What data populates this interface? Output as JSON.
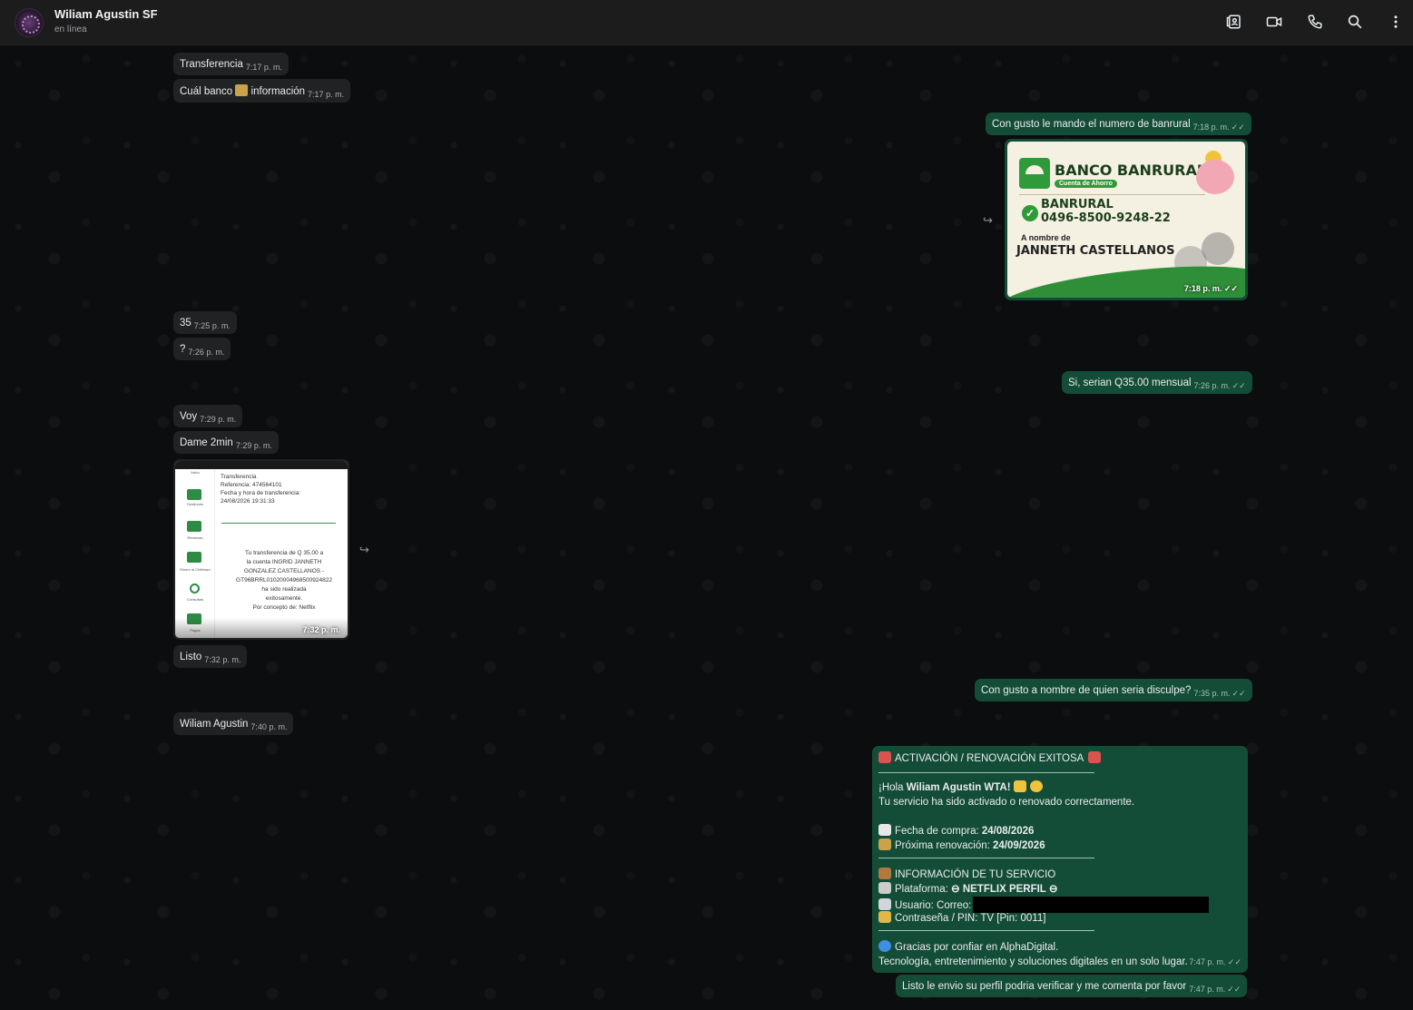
{
  "header": {
    "name": "Wiliam Agustin SF",
    "status": "en línea",
    "icons": [
      "contact-card-icon",
      "video-call-icon",
      "phone-icon",
      "search-icon",
      "more-options-icon"
    ]
  },
  "messages": {
    "m1": {
      "text": "Transferencia",
      "time": "7:17 p. m."
    },
    "m2": {
      "text_before": "Cuál banco",
      "text_after": "información",
      "time": "7:17 p. m."
    },
    "m3": {
      "text": "Con gusto le mando el numero de banrural",
      "time": "7:18 p. m."
    },
    "m4": {
      "time": "7:18 p. m."
    },
    "m5": {
      "text": "35",
      "time": "7:25 p. m."
    },
    "m6": {
      "text": "?",
      "time": "7:26 p. m."
    },
    "m7": {
      "text": "Si, serian Q35.00 mensual",
      "time": "7:26 p. m."
    },
    "m8": {
      "text": "Voy",
      "time": "7:29 p. m."
    },
    "m9": {
      "text": "Dame 2min",
      "time": "7:29 p. m."
    },
    "m10": {
      "time": "7:32 p. m."
    },
    "m11": {
      "text": "Listo",
      "time": "7:32 p. m."
    },
    "m12": {
      "text": "Con gusto a nombre de quien seria disculpe?",
      "time": "7:35 p. m."
    },
    "m13": {
      "text": "Wiliam Agustin",
      "time": "7:40 p. m."
    },
    "m14": {
      "time": "7:47 p. m."
    },
    "m15": {
      "text": "Listo le envio su perfil podria verificar y me comenta por favor",
      "time": "7:47 p. m."
    }
  },
  "bank_image": {
    "title": "BANCO BANRURAL",
    "subtitle": "Cuenta de Ahorro",
    "bank": "BANRURAL",
    "account": "0496-8500-9248-22",
    "to_label": "A nombre de",
    "holder": "JANNETH CASTELLANOS"
  },
  "transfer_image": {
    "title": "Transferencia",
    "reference": "Referencia:  474564101",
    "date_label": "Fecha y hora de transferencia:",
    "date": "24/08/2026 19:31:33",
    "body1": "Tu transferencia de  Q 35.00  a",
    "body2": "la cuenta  INGRID JANNETH",
    "body3": "GONZALEZ CASTELLANOS -",
    "body4": "GT96BRRL01020004968500924822",
    "body5": "ha sido realizada",
    "body6": "exitosamente.",
    "body7": "Por concepto de: Netflix",
    "side": [
      "Inicio",
      "Gestiones",
      "Remesas",
      "Dinero al Chiletazo",
      "Consultas",
      "Pagos"
    ]
  },
  "activation": {
    "title": "ACTIVACIÓN / RENOVACIÓN EXITOSA",
    "greet_pre": "¡Hola ",
    "greet_name": "Wiliam Agustin WTA!",
    "line2": "Tu servicio ha sido activado o renovado correctamente.",
    "purchase_label": "Fecha de compra: ",
    "purchase_date": "24/08/2026",
    "renew_label": "Próxima renovación: ",
    "renew_date": "24/09/2026",
    "info_title": "INFORMACIÓN DE TU SERVICIO",
    "platform_label": "Plataforma: ",
    "platform": "⊖ NETFLIX PERFIL ⊖",
    "user_label": "Usuario: Correo:",
    "pin_label": "Contraseña / PIN: TV [Pin: 0011]",
    "thanks": "Gracias por confiar en AlphaDigital.",
    "tagline": "Tecnología, entretenimiento y soluciones digitales en un solo lugar."
  },
  "colors": {
    "incoming": "#202223",
    "outgoing": "#144d37",
    "header": "#1c1c1d"
  }
}
